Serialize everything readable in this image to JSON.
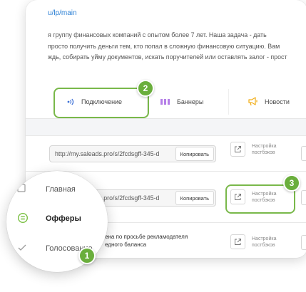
{
  "page": {
    "url": "u/lp/main",
    "description_lines": [
      "я группу финансовых компаний с опытом более 7 лет. Наша задача - дать",
      "просто получить деньги тем, кто попал в сложную финансовую ситуацию. Вам",
      "ждь, собирать уйму документов, искать поручителей или оставлять залог - прост"
    ]
  },
  "tabs": [
    {
      "label": "Подключение",
      "icon": "signal-icon",
      "color": "#3b6fd6"
    },
    {
      "label": "Баннеры",
      "icon": "banner-bars-icon",
      "color": "#b57ee8"
    },
    {
      "label": "Новости",
      "icon": "megaphone-icon",
      "color": "#f2b01e"
    }
  ],
  "rows": [
    {
      "link": "http://my.saleads.pro/s/2fcdsgff-345-d",
      "copy_label": "Копировать",
      "postback_label": "Настройка постбэков"
    },
    {
      "link": "http://my.saleads.pro/s/2fcdsgff-345-d",
      "copy_label": "Копировать",
      "postback_label": "Настройка постбэков"
    },
    {
      "text_lines": [
        "ена по просьбе рекламодателя",
        "едного баланса"
      ],
      "postback_label": "Настройка постбэков"
    }
  ],
  "sidebar_zoom": {
    "items": [
      {
        "label": "Главная",
        "icon": "home-icon"
      },
      {
        "label": "Офферы",
        "icon": "offers-icon",
        "active": true
      },
      {
        "label": "Голосование",
        "icon": "vote-check-icon"
      }
    ]
  },
  "badges": [
    "1",
    "2",
    "3"
  ],
  "colors": {
    "accent_green": "#6aae3c",
    "highlight_border": "#79b84a",
    "link_blue": "#2a7fd4",
    "active_menu_icon": "#7bc043"
  }
}
